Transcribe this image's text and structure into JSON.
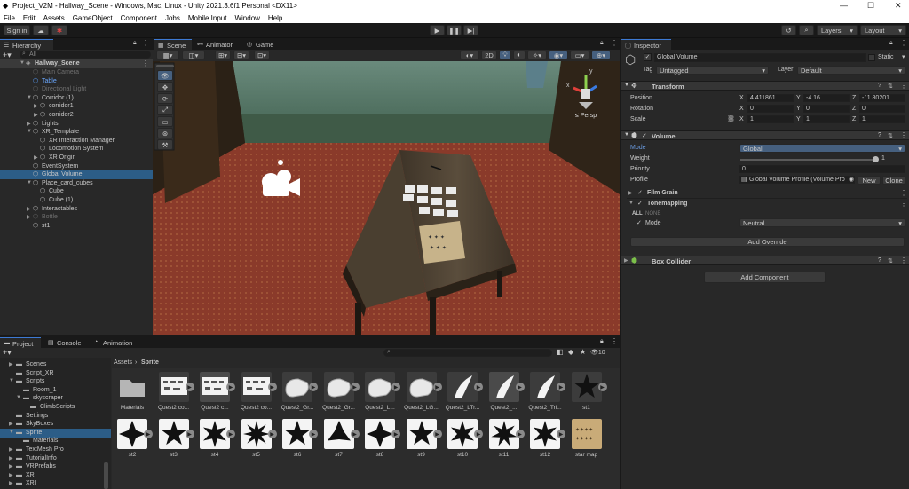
{
  "window": {
    "title": "Project_V2M - Hallway_Scene - Windows, Mac, Linux - Unity 2021.3.6f1 Personal <DX11>",
    "min": "—",
    "max": "☐",
    "close": "✕"
  },
  "menu": [
    "File",
    "Edit",
    "Assets",
    "GameObject",
    "Component",
    "Jobs",
    "Mobile Input",
    "Window",
    "Help"
  ],
  "toolbar": {
    "signin": "Sign in",
    "layers": "Layers",
    "layout": "Layout"
  },
  "hierarchy": {
    "tab": "Hierarchy",
    "search_placeholder": "All",
    "scene": "Hallway_Scene",
    "items": [
      {
        "label": "Main Camera",
        "depth": 1,
        "dim": true,
        "arrow": false
      },
      {
        "label": "Table",
        "depth": 1,
        "dim": false,
        "arrow": false,
        "blue": true
      },
      {
        "label": "Directional Light",
        "depth": 1,
        "dim": true,
        "arrow": false
      },
      {
        "label": "Corridor (1)",
        "depth": 1,
        "dim": false,
        "arrow": "open"
      },
      {
        "label": "corridor1",
        "depth": 2,
        "dim": false,
        "arrow": "closed"
      },
      {
        "label": "corridor2",
        "depth": 2,
        "dim": false,
        "arrow": "closed"
      },
      {
        "label": "Lights",
        "depth": 1,
        "dim": false,
        "arrow": "closed"
      },
      {
        "label": "XR_Template",
        "depth": 1,
        "dim": false,
        "arrow": "open"
      },
      {
        "label": "XR Interaction Manager",
        "depth": 2,
        "dim": false,
        "arrow": false
      },
      {
        "label": "Locomotion System",
        "depth": 2,
        "dim": false,
        "arrow": false
      },
      {
        "label": "XR Origin",
        "depth": 2,
        "dim": false,
        "arrow": "closed"
      },
      {
        "label": "EventSystem",
        "depth": 1,
        "dim": false,
        "arrow": false
      },
      {
        "label": "Global Volume",
        "depth": 1,
        "dim": false,
        "arrow": false,
        "selected": true
      },
      {
        "label": "Place_card_cubes",
        "depth": 1,
        "dim": false,
        "arrow": "open"
      },
      {
        "label": "Cube",
        "depth": 2,
        "dim": false,
        "arrow": false
      },
      {
        "label": "Cube (1)",
        "depth": 2,
        "dim": false,
        "arrow": false
      },
      {
        "label": "Interactables",
        "depth": 1,
        "dim": false,
        "arrow": "closed"
      },
      {
        "label": "Bottle",
        "depth": 1,
        "dim": true,
        "arrow": "closed"
      },
      {
        "label": "st1",
        "depth": 1,
        "dim": false,
        "arrow": false
      }
    ]
  },
  "scene_tabs": [
    "Scene",
    "Animator",
    "Game"
  ],
  "scene": {
    "persp": "Persp",
    "mode2d": "2D",
    "gizmo_y": "y",
    "gizmo_x": "x"
  },
  "inspector": {
    "tab": "Inspector",
    "object_name": "Global Volume",
    "static_label": "Static",
    "tag_label": "Tag",
    "tag_value": "Untagged",
    "layer_label": "Layer",
    "layer_value": "Default",
    "transform": {
      "title": "Transform",
      "position": {
        "label": "Position",
        "x": "4.411861",
        "y": "-4.16",
        "z": "-11.80201"
      },
      "rotation": {
        "label": "Rotation",
        "x": "0",
        "y": "0",
        "z": "0"
      },
      "scale": {
        "label": "Scale",
        "x": "1",
        "y": "1",
        "z": "1"
      }
    },
    "volume": {
      "title": "Volume",
      "mode_label": "Mode",
      "mode_value": "Global",
      "weight_label": "Weight",
      "weight_value": "1",
      "priority_label": "Priority",
      "priority_value": "0",
      "profile_label": "Profile",
      "profile_value": "Global Volume Profile (Volume Pro",
      "new_btn": "New",
      "clone_btn": "Clone",
      "film_grain": "Film Grain",
      "tonemapping": "Tonemapping",
      "all": "ALL",
      "none": "NONE",
      "tm_mode_label": "Mode",
      "tm_mode_value": "Neutral",
      "add_override": "Add Override"
    },
    "box_collider": "Box Collider",
    "add_component": "Add Component"
  },
  "project": {
    "tabs": [
      "Project",
      "Console",
      "Animation"
    ],
    "tree": [
      {
        "label": "Scenes",
        "depth": 1,
        "arrow": "closed"
      },
      {
        "label": "Script_XR",
        "depth": 1,
        "arrow": false
      },
      {
        "label": "Scripts",
        "depth": 1,
        "arrow": "open"
      },
      {
        "label": "Room_1",
        "depth": 2,
        "arrow": false
      },
      {
        "label": "skyscraper",
        "depth": 2,
        "arrow": "open"
      },
      {
        "label": "ClimbScripts",
        "depth": 3,
        "arrow": false
      },
      {
        "label": "Settings",
        "depth": 1,
        "arrow": false
      },
      {
        "label": "SkyBoxes",
        "depth": 1,
        "arrow": "closed"
      },
      {
        "label": "Sprite",
        "depth": 1,
        "arrow": "open",
        "selected": true
      },
      {
        "label": "Materials",
        "depth": 2,
        "arrow": false
      },
      {
        "label": "TextMesh Pro",
        "depth": 1,
        "arrow": "closed"
      },
      {
        "label": "TutorialInfo",
        "depth": 1,
        "arrow": "closed"
      },
      {
        "label": "VRPrefabs",
        "depth": 1,
        "arrow": "closed"
      },
      {
        "label": "XR",
        "depth": 1,
        "arrow": "closed"
      },
      {
        "label": "XRI",
        "depth": 1,
        "arrow": "closed"
      }
    ],
    "breadcrumb_root": "Assets",
    "breadcrumb_leaf": "Sprite",
    "count": "10",
    "assets_row1": [
      {
        "label": "Materials",
        "kind": "folder"
      },
      {
        "label": "Quest2 co...",
        "kind": "img"
      },
      {
        "label": "Quest2 c...",
        "kind": "img",
        "selected": true
      },
      {
        "label": "Quest2 co...",
        "kind": "img"
      },
      {
        "label": "Quest2_Gr...",
        "kind": "ctrl"
      },
      {
        "label": "Quest2_Gr...",
        "kind": "ctrl"
      },
      {
        "label": "Quest2_L...",
        "kind": "ctrl"
      },
      {
        "label": "Quest2_LG...",
        "kind": "ctrl"
      },
      {
        "label": "Quest2_LTr...",
        "kind": "horn"
      },
      {
        "label": "Quest2_...",
        "kind": "horn",
        "selected": true
      },
      {
        "label": "Quest2_Tri...",
        "kind": "horn"
      },
      {
        "label": "st1",
        "kind": "star"
      }
    ],
    "assets_row2": [
      {
        "label": "st2"
      },
      {
        "label": "st3"
      },
      {
        "label": "st4"
      },
      {
        "label": "st5"
      },
      {
        "label": "st6"
      },
      {
        "label": "st7"
      },
      {
        "label": "st8"
      },
      {
        "label": "st9"
      },
      {
        "label": "st10"
      },
      {
        "label": "st11"
      },
      {
        "label": "st12"
      },
      {
        "label": "star map"
      }
    ]
  }
}
